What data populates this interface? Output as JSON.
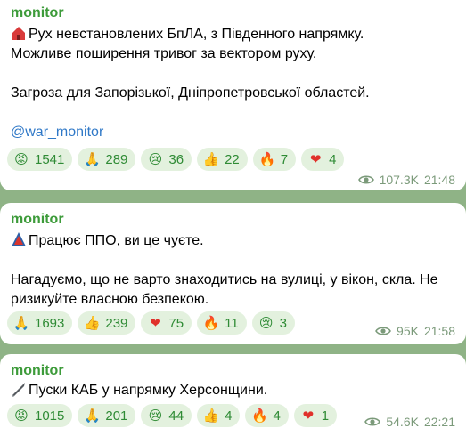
{
  "messages": [
    {
      "author": "monitor",
      "icon": "red-house-icon",
      "lines": [
        "Рух невстановлених БпЛА, з Південного напрямку.",
        "Можливе поширення тривог за вектором руху.",
        "",
        "Загроза для Запорізької, Дніпропетровської областей.",
        "",
        "@war_monitor"
      ],
      "reactions": [
        {
          "icon": "angry-face-icon",
          "count": "1541"
        },
        {
          "icon": "praying-hands-icon",
          "count": "289"
        },
        {
          "icon": "crying-face-icon",
          "count": "36"
        },
        {
          "icon": "thumbs-up-icon",
          "count": "22"
        },
        {
          "icon": "fire-icon",
          "count": "7"
        },
        {
          "icon": "heart-icon",
          "count": "4"
        }
      ],
      "views": "107.3K",
      "time": "21:48"
    },
    {
      "author": "monitor",
      "icon": "warning-triangle-icon",
      "lines": [
        "Працює ППО, ви це чуєте.",
        "",
        "Нагадуємо, що не варто знаходитись на вулиці, у вікон, скла. Не ризикуйте власною безпекою."
      ],
      "reactions": [
        {
          "icon": "praying-hands-icon",
          "count": "1693"
        },
        {
          "icon": "thumbs-up-icon",
          "count": "239"
        },
        {
          "icon": "heart-icon",
          "count": "75"
        },
        {
          "icon": "fire-icon",
          "count": "11"
        },
        {
          "icon": "crying-face-icon",
          "count": "3"
        }
      ],
      "views": "95K",
      "time": "21:58"
    },
    {
      "author": "monitor",
      "icon": "missile-icon",
      "lines": [
        "Пуски КАБ у напрямку Херсонщини."
      ],
      "reactions": [
        {
          "icon": "angry-face-icon",
          "count": "1015"
        },
        {
          "icon": "praying-hands-icon",
          "count": "201"
        },
        {
          "icon": "crying-face-icon",
          "count": "44"
        },
        {
          "icon": "thumbs-up-icon",
          "count": "4"
        },
        {
          "icon": "fire-icon",
          "count": "4"
        },
        {
          "icon": "heart-icon",
          "count": "1"
        }
      ],
      "views": "54.6K",
      "time": "22:21"
    }
  ],
  "colors": {
    "background": "#8fb386",
    "bubble": "#ffffff",
    "author": "#3d9b3a",
    "link": "#2f78c7",
    "reaction_bg": "#e3f1de",
    "reaction_text": "#2f8b35",
    "meta": "#7b9a7a"
  }
}
